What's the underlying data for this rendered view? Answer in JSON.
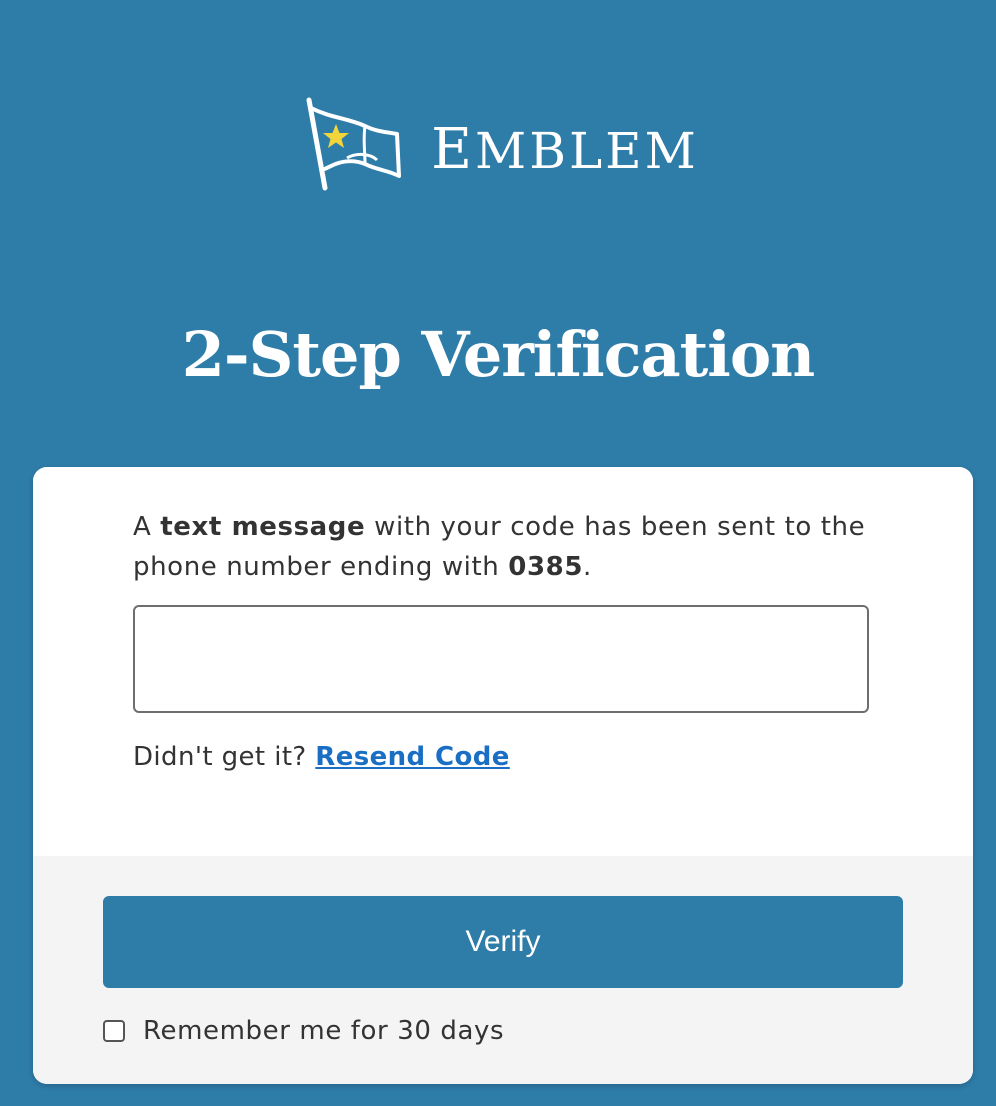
{
  "brand": {
    "name_first": "E",
    "name_rest": "MBLEM",
    "logo_icon": "flag-with-star-icon",
    "star_color": "#f2d43b"
  },
  "page": {
    "title": "2-Step Verification",
    "background_color": "#2e7ca8"
  },
  "message": {
    "prefix": "A ",
    "emphasis": "text message",
    "middle": " with your code has been sent to the phone number ending with ",
    "phone_last_digits": "0385",
    "suffix": "."
  },
  "code_input": {
    "value": "",
    "placeholder": ""
  },
  "resend": {
    "prompt": "Didn't get it? ",
    "link_label": "Resend Code"
  },
  "footer": {
    "verify_label": "Verify",
    "remember_label": "Remember me for 30 days",
    "remember_checked": false
  }
}
